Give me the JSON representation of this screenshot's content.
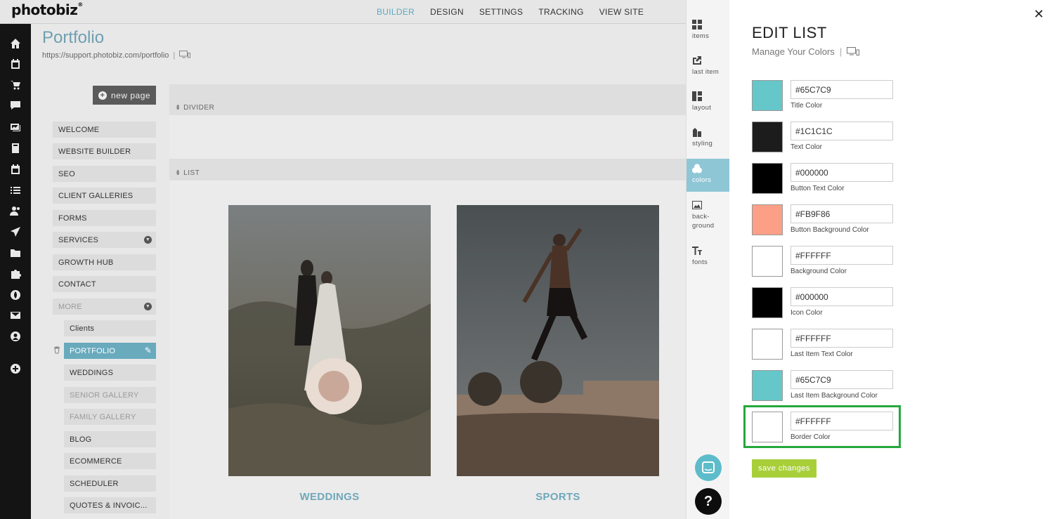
{
  "app": {
    "logo": "photobiz",
    "logo_mark": "®"
  },
  "topnav": [
    {
      "label": "BUILDER",
      "active": true
    },
    {
      "label": "DESIGN",
      "active": false
    },
    {
      "label": "SETTINGS",
      "active": false
    },
    {
      "label": "TRACKING",
      "active": false
    },
    {
      "label": "VIEW SITE",
      "active": false
    }
  ],
  "leftnav_icons": [
    "home-icon",
    "calendar-icon",
    "cart-icon",
    "chat-icon",
    "gallery-icon",
    "book-icon",
    "event-icon",
    "list-icon",
    "users-icon",
    "send-icon",
    "folder-icon",
    "puzzle-icon",
    "globe-icon",
    "mail-icon",
    "account-icon",
    "add-icon"
  ],
  "page": {
    "title": "Portfolio",
    "url": "https://support.photobiz.com/portfolio",
    "sep": "|"
  },
  "new_page_label": "new page",
  "pages": [
    {
      "label": "WELCOME"
    },
    {
      "label": "WEBSITE BUILDER"
    },
    {
      "label": "SEO"
    },
    {
      "label": "CLIENT GALLERIES"
    },
    {
      "label": "FORMS"
    },
    {
      "label": "SERVICES"
    },
    {
      "label": "GROWTH HUB"
    },
    {
      "label": "CONTACT"
    },
    {
      "label": "MORE"
    },
    {
      "label": "Clients"
    },
    {
      "label": "PORTFOLIO"
    },
    {
      "label": "WEDDINGS"
    },
    {
      "label": "SENIOR GALLERY"
    },
    {
      "label": "FAMILY GALLERY"
    },
    {
      "label": "BLOG"
    },
    {
      "label": "ECOMMERCE"
    },
    {
      "label": "SCHEDULER"
    },
    {
      "label": "QUOTES & INVOIC..."
    }
  ],
  "sections": {
    "divider": "DIVIDER",
    "list": "LIST"
  },
  "list_items": [
    {
      "label": "WEDDINGS"
    },
    {
      "label": "SPORTS"
    }
  ],
  "tabs": [
    {
      "label": "items",
      "icon": "grid-icon"
    },
    {
      "label": "last item",
      "icon": "share-icon"
    },
    {
      "label": "layout",
      "icon": "layout-icon"
    },
    {
      "label": "styling",
      "icon": "styling-icon"
    },
    {
      "label": "colors",
      "icon": "colors-icon",
      "active": true
    },
    {
      "label": "back-\nground",
      "icon": "image-icon"
    },
    {
      "label": "fonts",
      "icon": "fonts-icon"
    }
  ],
  "panel": {
    "title": "EDIT LIST",
    "subtitle": "Manage Your Colors",
    "sep": "|",
    "save_label": "save changes",
    "help": "?"
  },
  "colors": [
    {
      "label": "Title Color",
      "value": "#65C7C9",
      "swatch": "#65C7C9"
    },
    {
      "label": "Text Color",
      "value": "#1C1C1C",
      "swatch": "#1C1C1C"
    },
    {
      "label": "Button Text Color",
      "value": "#000000",
      "swatch": "#000000"
    },
    {
      "label": "Button Background Color",
      "value": "#FB9F86",
      "swatch": "#FB9F86"
    },
    {
      "label": "Background Color",
      "value": "#FFFFFF",
      "swatch": "#FFFFFF"
    },
    {
      "label": "Icon Color",
      "value": "#000000",
      "swatch": "#000000"
    },
    {
      "label": "Last Item Text Color",
      "value": "#FFFFFF",
      "swatch": "#FFFFFF"
    },
    {
      "label": "Last Item Background Color",
      "value": "#65C7C9",
      "swatch": "#65C7C9"
    },
    {
      "label": "Border Color",
      "value": "#FFFFFF",
      "swatch": "#FFFFFF"
    }
  ],
  "theme": {
    "accent": "#69aabd",
    "save": "#a8cf3a",
    "highlight": "#25a83c"
  }
}
